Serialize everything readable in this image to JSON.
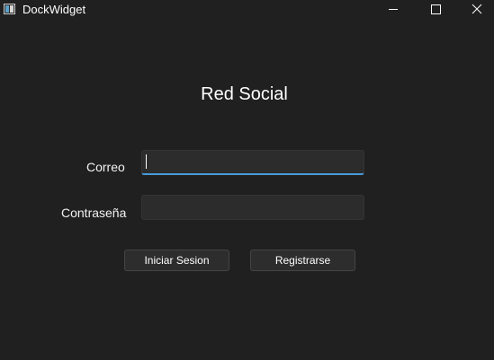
{
  "window": {
    "title": "DockWidget",
    "icon": "app-window-icon",
    "controls": [
      "minimize-icon",
      "maximize-icon",
      "close-icon"
    ]
  },
  "form": {
    "heading": "Red Social",
    "email_label": "Correo",
    "email_value": "",
    "password_label": "Contraseña",
    "password_value": "",
    "login_button": "Iniciar Sesion",
    "register_button": "Registrarse"
  },
  "colors": {
    "background": "#202020",
    "accent": "#4a9ad8"
  }
}
